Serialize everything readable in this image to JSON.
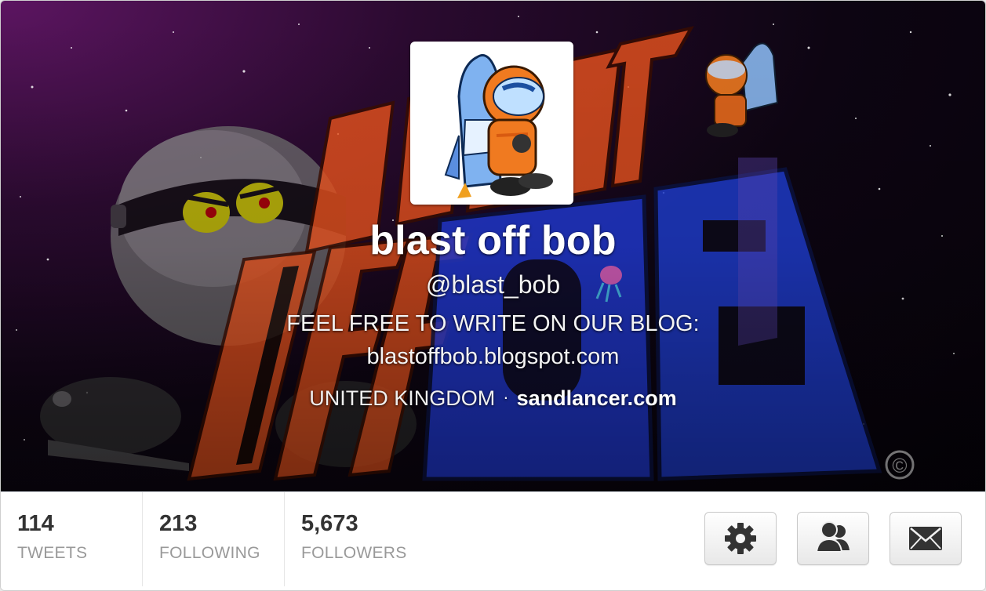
{
  "profile": {
    "name": "blast off bob",
    "handle": "@blast_bob",
    "bio_line1": "FEEL FREE TO WRITE ON OUR BLOG:",
    "bio_line2": "blastoffbob.blogspot.com",
    "location": "UNITED KINGDOM",
    "separator": "·",
    "website": "sandlancer.com"
  },
  "header_art": {
    "title_top": "BLAST",
    "title_bottom_left": "OFF",
    "title_bottom_right": "BOB",
    "copyright": "©"
  },
  "stats": {
    "tweets": {
      "value": "114",
      "label": "TWEETS"
    },
    "following": {
      "value": "213",
      "label": "FOLLOWING"
    },
    "followers": {
      "value": "5,673",
      "label": "FOLLOWERS"
    }
  },
  "actions": {
    "settings_icon": "gear-icon",
    "people_icon": "people-icon",
    "message_icon": "envelope-icon"
  },
  "colors": {
    "header_purple": "#5c1561",
    "title_orange": "#e8521e",
    "title_blue": "#1e3fd0",
    "stat_number": "#333333",
    "stat_label": "#999999"
  }
}
